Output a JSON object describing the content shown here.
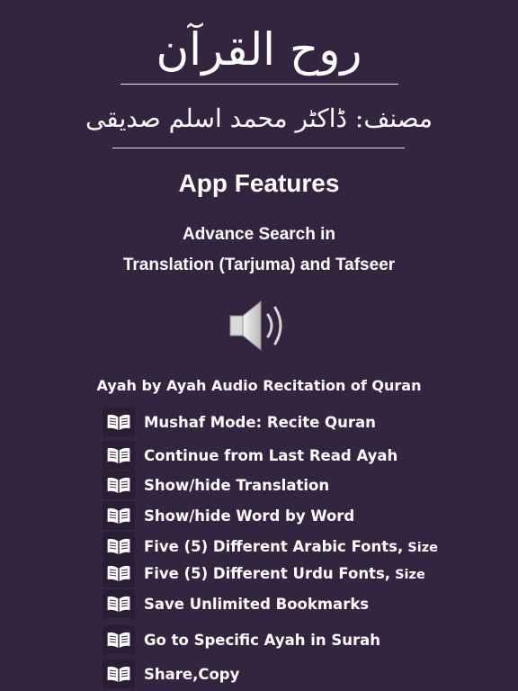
{
  "header": {
    "title_urdu": "روح القرآن",
    "author_urdu": "مصنف: ڈاکٹر محمد اسلم صدیقی"
  },
  "main": {
    "features_heading": "App Features",
    "search_line_1": "Advance Search in",
    "search_line_2": "Translation (Tarjuma) and Tafseer",
    "speaker_icon": "speaker-volume-icon",
    "audio_caption": "Ayah by Ayah Audio Recitation of Quran",
    "feature_icon": "open-book-icon",
    "features": [
      {
        "label": "Mushaf Mode: Recite Quran"
      },
      {
        "label": "Continue from Last Read Ayah"
      },
      {
        "label": "Show/hide Translation"
      },
      {
        "label": "Show/hide Word by Word"
      },
      {
        "label": "Five (5) Different Arabic Fonts,",
        "suffix": " Size"
      },
      {
        "label": "Five (5) Different Urdu Fonts,",
        "suffix": " Size"
      },
      {
        "label": "Save Unlimited Bookmarks"
      },
      {
        "label": "Go to Specific Ayah in Surah"
      },
      {
        "label": "Share,Copy"
      }
    ]
  },
  "colors": {
    "background": "#332540",
    "text": "#ffffff",
    "icon_bg": "#2a1e34"
  }
}
